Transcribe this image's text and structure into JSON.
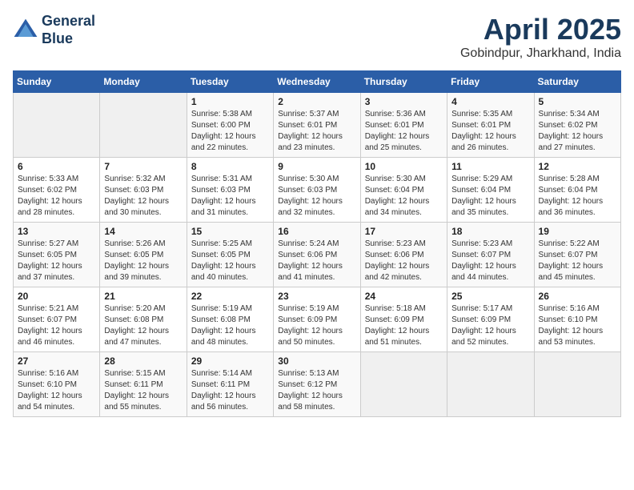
{
  "header": {
    "logo_line1": "General",
    "logo_line2": "Blue",
    "month": "April 2025",
    "location": "Gobindpur, Jharkhand, India"
  },
  "days_of_week": [
    "Sunday",
    "Monday",
    "Tuesday",
    "Wednesday",
    "Thursday",
    "Friday",
    "Saturday"
  ],
  "weeks": [
    [
      {
        "day": "",
        "detail": ""
      },
      {
        "day": "",
        "detail": ""
      },
      {
        "day": "1",
        "detail": "Sunrise: 5:38 AM\nSunset: 6:00 PM\nDaylight: 12 hours\nand 22 minutes."
      },
      {
        "day": "2",
        "detail": "Sunrise: 5:37 AM\nSunset: 6:01 PM\nDaylight: 12 hours\nand 23 minutes."
      },
      {
        "day": "3",
        "detail": "Sunrise: 5:36 AM\nSunset: 6:01 PM\nDaylight: 12 hours\nand 25 minutes."
      },
      {
        "day": "4",
        "detail": "Sunrise: 5:35 AM\nSunset: 6:01 PM\nDaylight: 12 hours\nand 26 minutes."
      },
      {
        "day": "5",
        "detail": "Sunrise: 5:34 AM\nSunset: 6:02 PM\nDaylight: 12 hours\nand 27 minutes."
      }
    ],
    [
      {
        "day": "6",
        "detail": "Sunrise: 5:33 AM\nSunset: 6:02 PM\nDaylight: 12 hours\nand 28 minutes."
      },
      {
        "day": "7",
        "detail": "Sunrise: 5:32 AM\nSunset: 6:03 PM\nDaylight: 12 hours\nand 30 minutes."
      },
      {
        "day": "8",
        "detail": "Sunrise: 5:31 AM\nSunset: 6:03 PM\nDaylight: 12 hours\nand 31 minutes."
      },
      {
        "day": "9",
        "detail": "Sunrise: 5:30 AM\nSunset: 6:03 PM\nDaylight: 12 hours\nand 32 minutes."
      },
      {
        "day": "10",
        "detail": "Sunrise: 5:30 AM\nSunset: 6:04 PM\nDaylight: 12 hours\nand 34 minutes."
      },
      {
        "day": "11",
        "detail": "Sunrise: 5:29 AM\nSunset: 6:04 PM\nDaylight: 12 hours\nand 35 minutes."
      },
      {
        "day": "12",
        "detail": "Sunrise: 5:28 AM\nSunset: 6:04 PM\nDaylight: 12 hours\nand 36 minutes."
      }
    ],
    [
      {
        "day": "13",
        "detail": "Sunrise: 5:27 AM\nSunset: 6:05 PM\nDaylight: 12 hours\nand 37 minutes."
      },
      {
        "day": "14",
        "detail": "Sunrise: 5:26 AM\nSunset: 6:05 PM\nDaylight: 12 hours\nand 39 minutes."
      },
      {
        "day": "15",
        "detail": "Sunrise: 5:25 AM\nSunset: 6:05 PM\nDaylight: 12 hours\nand 40 minutes."
      },
      {
        "day": "16",
        "detail": "Sunrise: 5:24 AM\nSunset: 6:06 PM\nDaylight: 12 hours\nand 41 minutes."
      },
      {
        "day": "17",
        "detail": "Sunrise: 5:23 AM\nSunset: 6:06 PM\nDaylight: 12 hours\nand 42 minutes."
      },
      {
        "day": "18",
        "detail": "Sunrise: 5:23 AM\nSunset: 6:07 PM\nDaylight: 12 hours\nand 44 minutes."
      },
      {
        "day": "19",
        "detail": "Sunrise: 5:22 AM\nSunset: 6:07 PM\nDaylight: 12 hours\nand 45 minutes."
      }
    ],
    [
      {
        "day": "20",
        "detail": "Sunrise: 5:21 AM\nSunset: 6:07 PM\nDaylight: 12 hours\nand 46 minutes."
      },
      {
        "day": "21",
        "detail": "Sunrise: 5:20 AM\nSunset: 6:08 PM\nDaylight: 12 hours\nand 47 minutes."
      },
      {
        "day": "22",
        "detail": "Sunrise: 5:19 AM\nSunset: 6:08 PM\nDaylight: 12 hours\nand 48 minutes."
      },
      {
        "day": "23",
        "detail": "Sunrise: 5:19 AM\nSunset: 6:09 PM\nDaylight: 12 hours\nand 50 minutes."
      },
      {
        "day": "24",
        "detail": "Sunrise: 5:18 AM\nSunset: 6:09 PM\nDaylight: 12 hours\nand 51 minutes."
      },
      {
        "day": "25",
        "detail": "Sunrise: 5:17 AM\nSunset: 6:09 PM\nDaylight: 12 hours\nand 52 minutes."
      },
      {
        "day": "26",
        "detail": "Sunrise: 5:16 AM\nSunset: 6:10 PM\nDaylight: 12 hours\nand 53 minutes."
      }
    ],
    [
      {
        "day": "27",
        "detail": "Sunrise: 5:16 AM\nSunset: 6:10 PM\nDaylight: 12 hours\nand 54 minutes."
      },
      {
        "day": "28",
        "detail": "Sunrise: 5:15 AM\nSunset: 6:11 PM\nDaylight: 12 hours\nand 55 minutes."
      },
      {
        "day": "29",
        "detail": "Sunrise: 5:14 AM\nSunset: 6:11 PM\nDaylight: 12 hours\nand 56 minutes."
      },
      {
        "day": "30",
        "detail": "Sunrise: 5:13 AM\nSunset: 6:12 PM\nDaylight: 12 hours\nand 58 minutes."
      },
      {
        "day": "",
        "detail": ""
      },
      {
        "day": "",
        "detail": ""
      },
      {
        "day": "",
        "detail": ""
      }
    ]
  ]
}
